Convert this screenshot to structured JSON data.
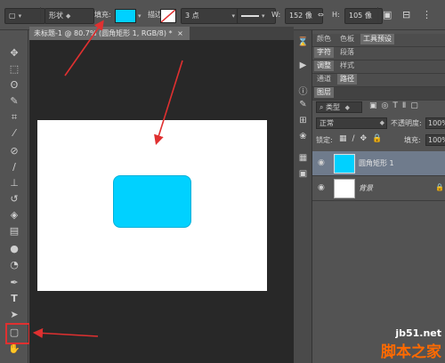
{
  "options_bar": {
    "mode_value": "形状",
    "fill_label": "填充:",
    "stroke_label": "描边:",
    "stroke_width_value": "3 点",
    "w_label": "W:",
    "w_value": "152 像",
    "link_glyph": "⇔",
    "h_label": "H:",
    "h_value": "105 像"
  },
  "document": {
    "tab_title": "未标题-1 @ 80.7% (圆角矩形 1, RGB/8) *",
    "close_glyph": "×"
  },
  "panels": {
    "group1_tabs": [
      "颜色",
      "色板",
      "工具预设"
    ],
    "group2_tabs": [
      "字符",
      "段落"
    ],
    "group3_tabs": [
      "调整",
      "样式"
    ],
    "group4_tabs": [
      "通道",
      "路径"
    ],
    "layers_tab": "图层",
    "filter_kind": "类型",
    "blend_mode": "正常",
    "opacity_label": "不透明度:",
    "opacity_value": "100%",
    "lock_label": "锁定:",
    "fill_label": "填充:",
    "fill_value": "100%",
    "layers": [
      {
        "name": "圆角矩形 1",
        "selected": true
      },
      {
        "name": "背景",
        "selected": false
      }
    ]
  },
  "colors": {
    "shape_fill": "#00d1ff",
    "selection_box": "#e03030",
    "annotation_arrow": "#e03030"
  },
  "watermark": {
    "line1": "jb51.net",
    "line2": "脚本之家"
  }
}
